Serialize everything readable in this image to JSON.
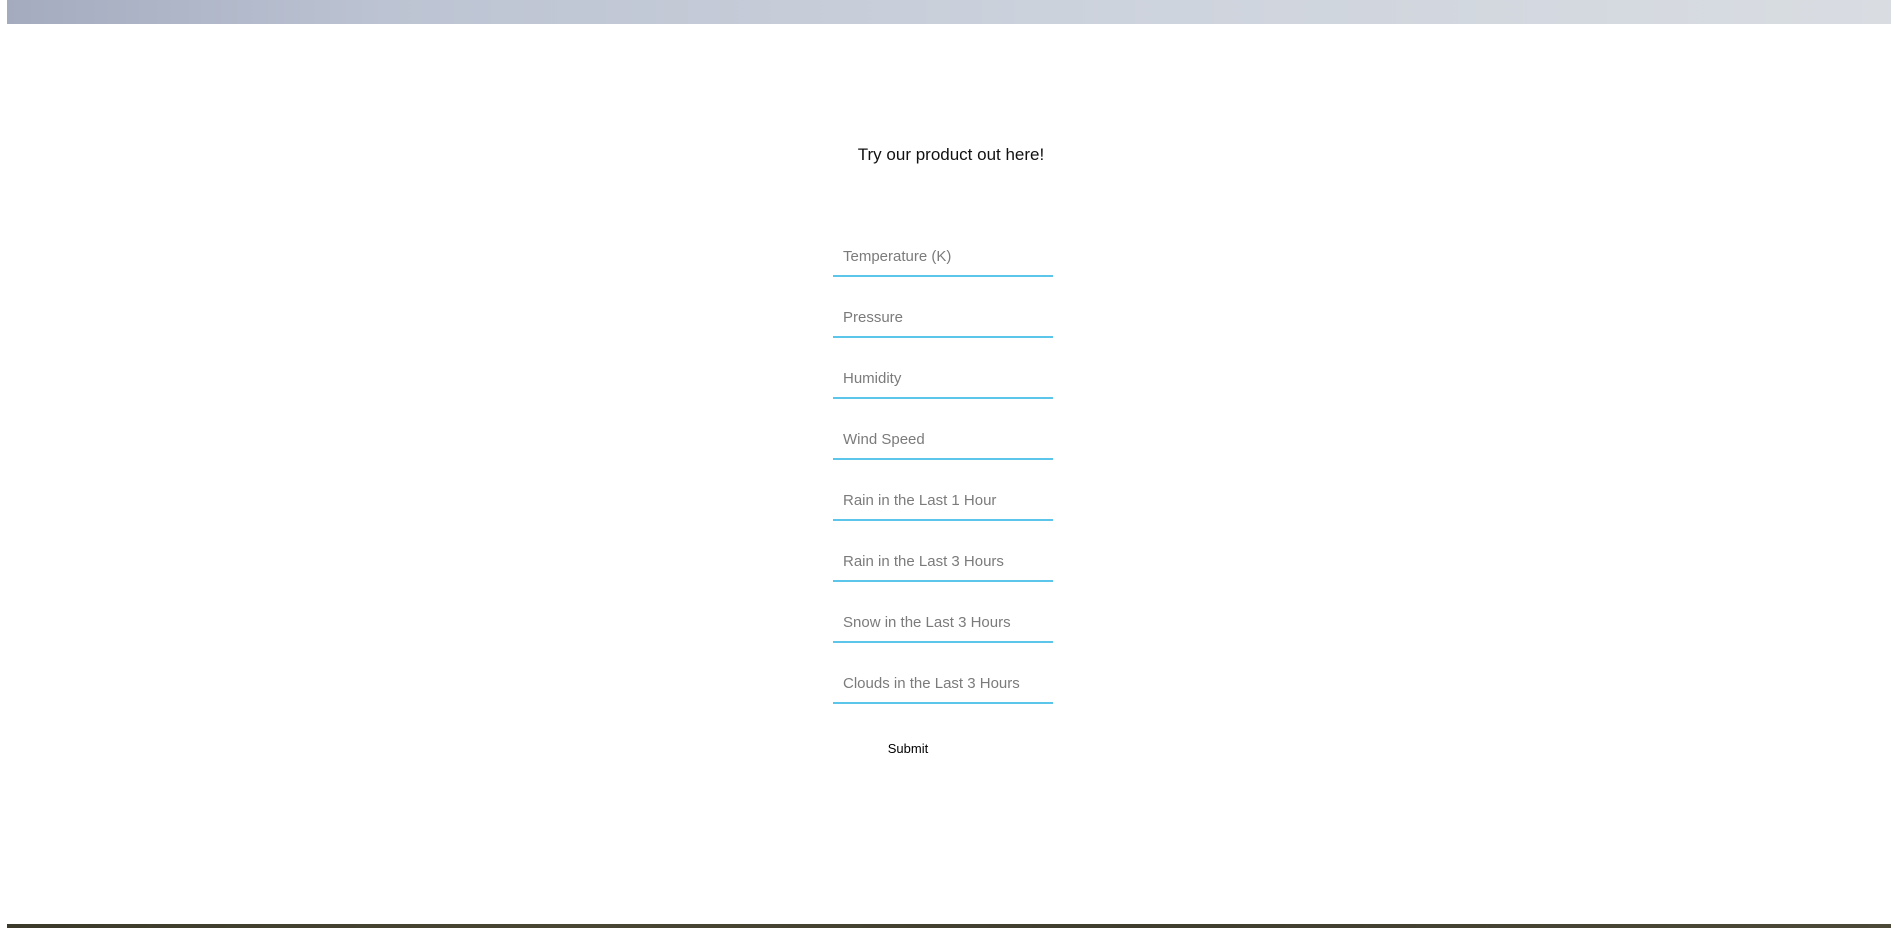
{
  "heading": "Try our product out here!",
  "form": {
    "fields": [
      {
        "placeholder": "Temperature (K)",
        "value": ""
      },
      {
        "placeholder": "Pressure",
        "value": ""
      },
      {
        "placeholder": "Humidity",
        "value": ""
      },
      {
        "placeholder": "Wind Speed",
        "value": ""
      },
      {
        "placeholder": "Rain in the Last 1 Hour",
        "value": ""
      },
      {
        "placeholder": "Rain in the Last 3 Hours",
        "value": ""
      },
      {
        "placeholder": "Snow in the Last 3 Hours",
        "value": ""
      },
      {
        "placeholder": "Clouds in the Last 3 Hours",
        "value": ""
      }
    ],
    "submit_label": "Submit"
  },
  "colors": {
    "field_underline": "#5bc6ea",
    "placeholder_text": "#7b7b7b",
    "banner_gradient_start": "#a4abbf",
    "banner_gradient_end": "#d9dde2"
  }
}
